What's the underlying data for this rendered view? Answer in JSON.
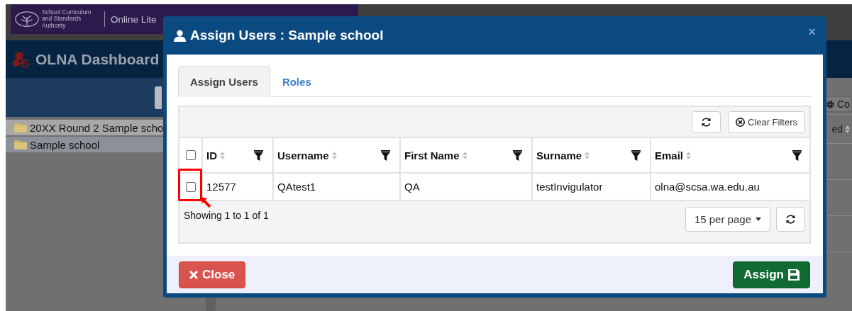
{
  "background": {
    "brand_text": "School Curriculum and Standards Authority",
    "app_title": "Online Lite",
    "dashboard_title": "OLNA Dashboard",
    "tree": [
      {
        "label": "20XX Round 2 Sample scho",
        "selected": false
      },
      {
        "label": "Sample school",
        "selected": true
      }
    ],
    "toolbar_button": "Co",
    "column_header": "ed"
  },
  "dialog": {
    "title": "Assign Users : Sample school",
    "close": "×",
    "tabs": [
      {
        "label": "Assign Users",
        "selected": true
      },
      {
        "label": "Roles",
        "selected": false
      }
    ],
    "toolbar": {
      "clear_filters": "Clear Filters"
    },
    "table": {
      "select_all_checked": false,
      "columns": [
        "ID",
        "Username",
        "First Name",
        "Surname",
        "Email"
      ],
      "rows": [
        {
          "checked": false,
          "cells": [
            "12577",
            "QAtest1",
            "QA",
            "testInvigulator",
            "olna@scsa.wa.edu.au"
          ]
        }
      ]
    },
    "pagination": {
      "summary": "Showing 1 to 1 of 1",
      "page_size": "15 per page"
    },
    "buttons": [
      {
        "kind": "close",
        "label": "Close"
      },
      {
        "kind": "assign",
        "label": "Assign"
      }
    ]
  }
}
